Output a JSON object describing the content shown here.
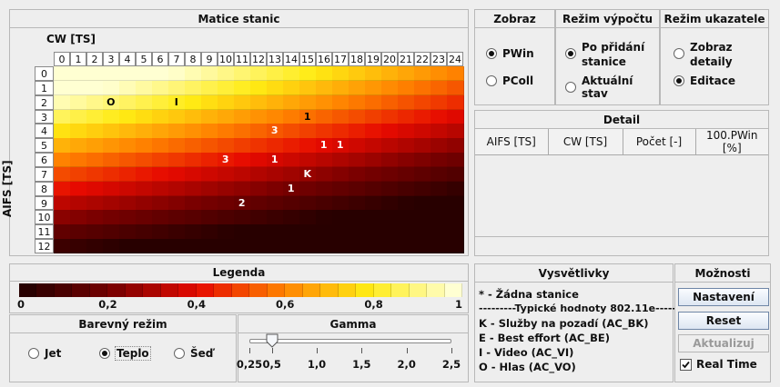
{
  "matrix": {
    "title": "Matice stanic",
    "cw_label": "CW [TS]",
    "aifs_label": "AIFS [TS]",
    "cw_ticks": [
      "0",
      "1",
      "2",
      "3",
      "4",
      "5",
      "6",
      "7",
      "8",
      "9",
      "10",
      "11",
      "12",
      "13",
      "14",
      "15",
      "16",
      "17",
      "18",
      "19",
      "20",
      "21",
      "22",
      "23",
      "24"
    ],
    "aifs_ticks": [
      "0",
      "1",
      "2",
      "3",
      "4",
      "5",
      "6",
      "7",
      "8",
      "9",
      "10",
      "11",
      "12"
    ],
    "markers": [
      {
        "row": 2,
        "col": 3,
        "text": "O"
      },
      {
        "row": 2,
        "col": 7,
        "text": "I"
      },
      {
        "row": 3,
        "col": 15,
        "text": "1"
      },
      {
        "row": 4,
        "col": 13,
        "text": "3"
      },
      {
        "row": 5,
        "col": 16,
        "text": "1"
      },
      {
        "row": 5,
        "col": 17,
        "text": "1"
      },
      {
        "row": 6,
        "col": 10,
        "text": "3"
      },
      {
        "row": 6,
        "col": 13,
        "text": "1"
      },
      {
        "row": 7,
        "col": 15,
        "text": "K"
      },
      {
        "row": 8,
        "col": 14,
        "text": "1"
      },
      {
        "row": 9,
        "col": 11,
        "text": "2"
      }
    ]
  },
  "zobraz": {
    "title": "Zobraz",
    "options": [
      "PWin",
      "PColl"
    ],
    "selected": 0
  },
  "rezim_vypoctu": {
    "title": "Režim výpočtu",
    "options": [
      [
        "Po přidání",
        "stanice"
      ],
      [
        "Aktuální stav"
      ]
    ],
    "selected": 0
  },
  "rezim_ukazatele": {
    "title": "Režim ukazatele",
    "options": [
      [
        "Zobraz",
        "detaily"
      ],
      [
        "Editace"
      ]
    ],
    "selected": 1
  },
  "detail": {
    "title": "Detail",
    "columns": [
      "AIFS [TS]",
      "CW [TS]",
      "Počet [-]",
      "100.PWin [%]"
    ]
  },
  "legenda": {
    "title": "Legenda",
    "ticks": [
      "0",
      "0,2",
      "0,4",
      "0,6",
      "0,8",
      "1"
    ]
  },
  "barevny_rezim": {
    "title": "Barevný režim",
    "options": [
      "Jet",
      "Teplo",
      "Šeď"
    ],
    "selected": 1
  },
  "gamma": {
    "title": "Gamma",
    "ticks": [
      "0,25",
      "0,5",
      "1,0",
      "1,5",
      "2,0",
      "2,5"
    ],
    "value": 0.5
  },
  "vysvetlivky": {
    "title": "Vysvětlivky",
    "lines": [
      "* - Žádna stanice",
      "---------Typické hodnoty 802.11e---------",
      "K - Služby na pozadí (AC_BK)",
      "E - Best effort (AC_BE)",
      "I - Video (AC_VI)",
      "O - Hlas (AC_VO)"
    ]
  },
  "moznosti": {
    "title": "Možnosti",
    "buttons": [
      "Nastavení",
      "Reset",
      "Aktualizuj"
    ],
    "realtime_label": "Real Time",
    "realtime_checked": true
  }
}
